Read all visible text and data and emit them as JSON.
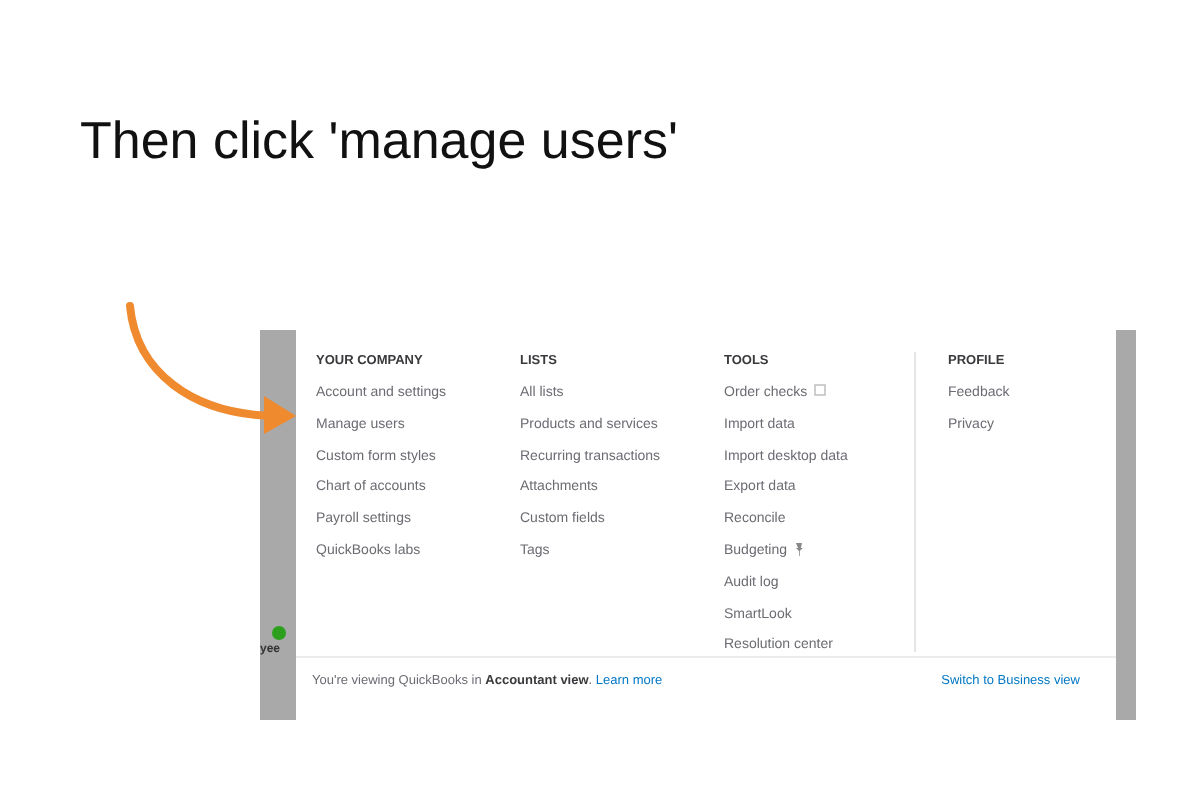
{
  "slide_title": "Then click 'manage users'",
  "sidebar": {
    "label": "yee"
  },
  "menu": {
    "columns": [
      {
        "heading": "YOUR COMPANY",
        "items": [
          {
            "label": "Account and settings",
            "kind": "plain"
          },
          {
            "label": "Manage users",
            "kind": "plain"
          },
          {
            "label": "Custom form styles",
            "kind": "plain"
          },
          {
            "label": "Chart of accounts",
            "kind": "plain"
          },
          {
            "label": "Payroll settings",
            "kind": "plain"
          },
          {
            "label": "QuickBooks labs",
            "kind": "plain"
          }
        ]
      },
      {
        "heading": "LISTS",
        "items": [
          {
            "label": "All lists",
            "kind": "plain"
          },
          {
            "label": "Products and services",
            "kind": "plain"
          },
          {
            "label": "Recurring transactions",
            "kind": "plain"
          },
          {
            "label": "Attachments",
            "kind": "plain"
          },
          {
            "label": "Custom fields",
            "kind": "plain"
          },
          {
            "label": "Tags",
            "kind": "plain"
          }
        ]
      },
      {
        "heading": "TOOLS",
        "items": [
          {
            "label": "Order checks",
            "kind": "external"
          },
          {
            "label": "Import data",
            "kind": "plain"
          },
          {
            "label": "Import desktop data",
            "kind": "plain"
          },
          {
            "label": "Export data",
            "kind": "plain"
          },
          {
            "label": "Reconcile",
            "kind": "plain"
          },
          {
            "label": "Budgeting",
            "kind": "pin"
          },
          {
            "label": "Audit log",
            "kind": "plain"
          },
          {
            "label": "SmartLook",
            "kind": "plain"
          },
          {
            "label": "Resolution center",
            "kind": "plain"
          }
        ]
      },
      {
        "heading": "PROFILE",
        "items": [
          {
            "label": "Feedback",
            "kind": "plain"
          },
          {
            "label": "Privacy",
            "kind": "plain"
          }
        ]
      }
    ]
  },
  "footer": {
    "notice": "You're viewing QuickBooks in **Accountant view**.",
    "link": "Learn more",
    "switch_link": "Switch to Business view"
  }
}
